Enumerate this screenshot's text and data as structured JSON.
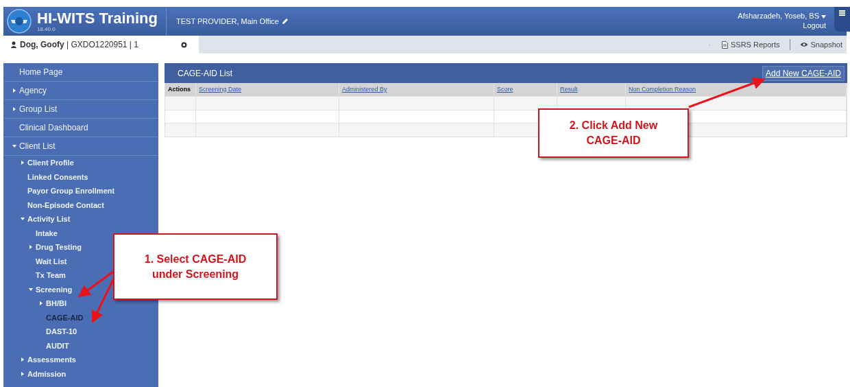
{
  "header": {
    "app_title": "HI-WITS Training",
    "version": "18.40.0",
    "provider": "TEST PROVIDER, Main Office",
    "user": "Afsharzadeh, Yoseb, BS",
    "logout": "Logout"
  },
  "client_tab": {
    "name": "Dog, Goofy",
    "details": " | GXDO1220951 | 1",
    "selected": true
  },
  "toolbar": {
    "dot": "·",
    "links": [
      "SSRS Reports",
      "Snapshot"
    ]
  },
  "sidebar": {
    "items": [
      {
        "label": "Home Page",
        "selected": false
      },
      {
        "label": "Agency",
        "selected": false,
        "expanded": false
      },
      {
        "label": "Group List",
        "selected": false,
        "expanded": false
      },
      {
        "label": "Clinical Dashboard",
        "selected": false
      },
      {
        "label": "Client List",
        "selected": false,
        "expanded": true,
        "children": [
          {
            "label": "Client Profile",
            "selected": false,
            "expanded": false
          },
          {
            "label": "Linked Consents",
            "selected": false
          },
          {
            "label": "Payor Group Enrollment",
            "selected": false
          },
          {
            "label": "Non-Episode Contact",
            "selected": false
          },
          {
            "label": "Activity List",
            "selected": false,
            "expanded": true,
            "children": [
              {
                "label": "Intake",
                "selected": false
              },
              {
                "label": "Drug Testing",
                "selected": false,
                "expanded": false
              },
              {
                "label": "Wait List",
                "selected": false
              },
              {
                "label": "Tx Team",
                "selected": false
              },
              {
                "label": "Screening",
                "selected": false,
                "expanded": true,
                "children": [
                  {
                    "label": "BH/BI",
                    "selected": false,
                    "expanded": false
                  },
                  {
                    "label": "CAGE-AID",
                    "selected": true
                  },
                  {
                    "label": "DAST-10",
                    "selected": false
                  },
                  {
                    "label": "AUDIT",
                    "selected": false
                  }
                ]
              }
            ]
          },
          {
            "label": "Assessments",
            "selected": false,
            "expanded": false
          },
          {
            "label": "Admission",
            "selected": false,
            "expanded": false
          }
        ]
      }
    ]
  },
  "panel": {
    "title": "CAGE-AID List",
    "action": "Add New CAGE-AID",
    "table": {
      "columns": [
        {
          "label": "Actions",
          "kind": "plain"
        },
        {
          "label": "Screening Date",
          "kind": "sortable"
        },
        {
          "label": "Administered By",
          "kind": "sortable"
        },
        {
          "label": "Score",
          "kind": "sortable"
        },
        {
          "label": "Result",
          "kind": "sortable"
        },
        {
          "label": "Non Completion Reason",
          "kind": "sortable"
        }
      ],
      "rows": [
        {
          "kind": "blank"
        },
        {
          "kind": "blank"
        },
        {
          "kind": "blank"
        }
      ]
    }
  },
  "annotations": [
    {
      "text": "1. Select CAGE-AID under Screening"
    },
    {
      "text": "2. Click Add New CAGE-AID"
    }
  ]
}
